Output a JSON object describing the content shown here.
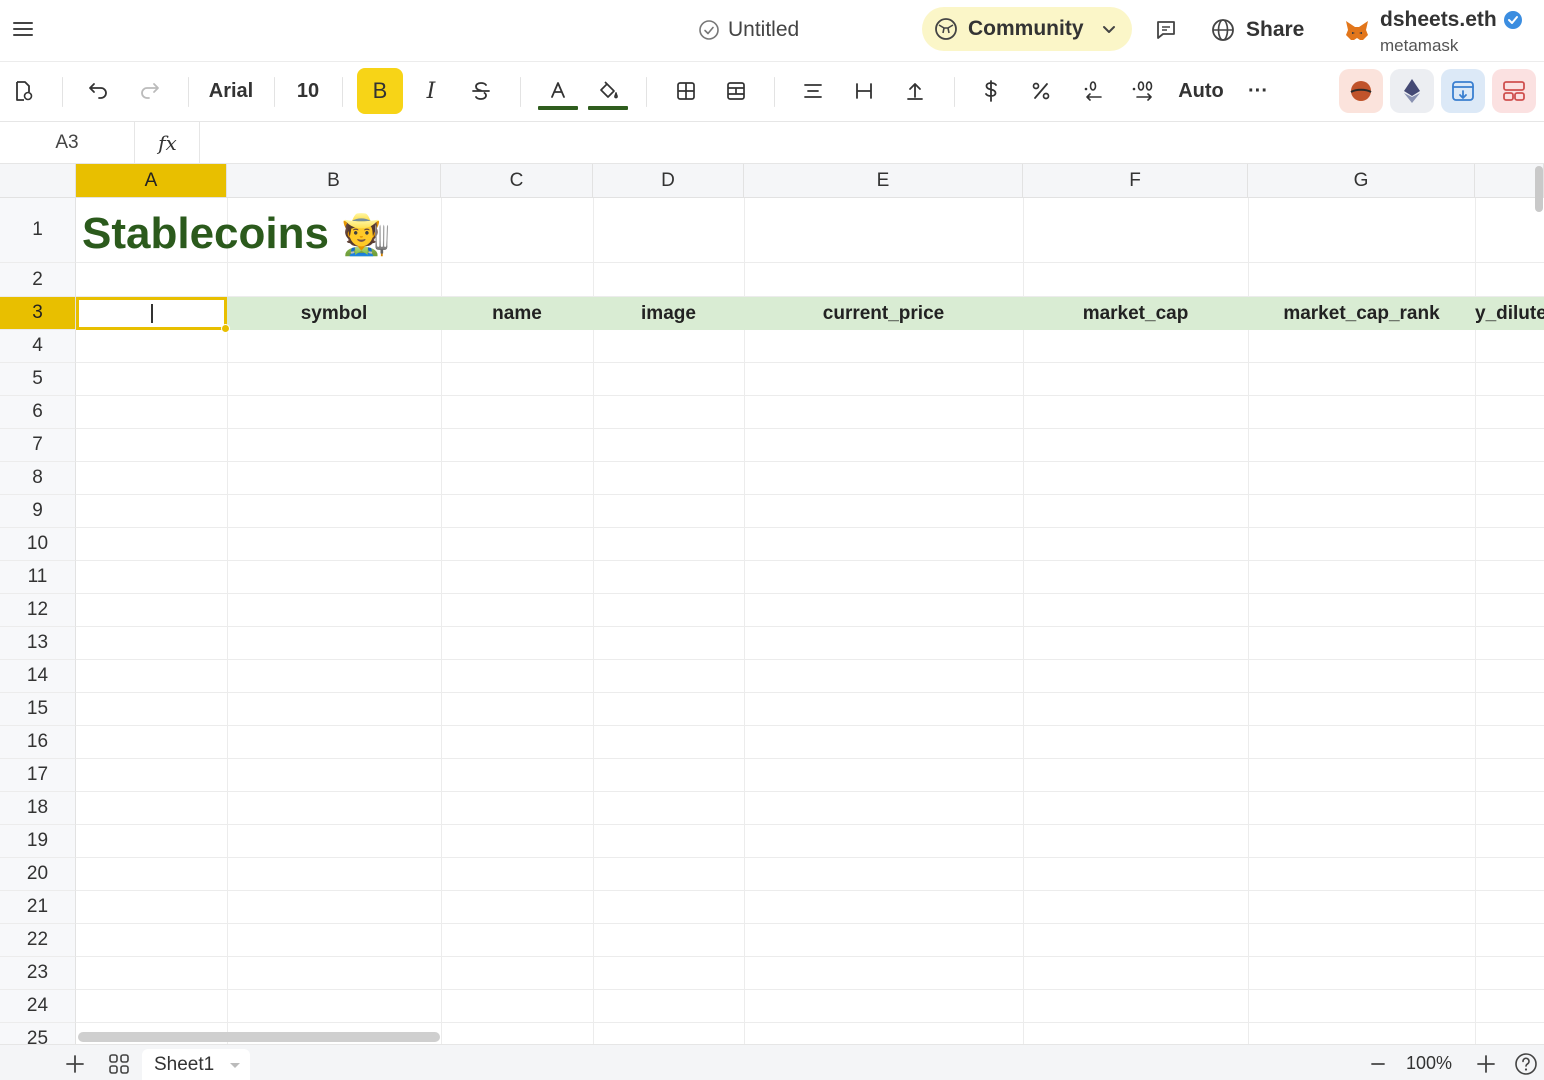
{
  "header": {
    "doc_title": "Untitled",
    "community_label": "Community",
    "share_label": "Share",
    "user_name": "dsheets.eth",
    "user_wallet": "metamask"
  },
  "toolbar": {
    "font_name": "Arial",
    "font_size": "10",
    "bold": "B",
    "italic": "I",
    "auto_label": "Auto",
    "more": "···",
    "text_color": "#2f5d1e",
    "fill_color": "#2f5d1e"
  },
  "formula": {
    "cell_ref": "A3",
    "fx_label": "fx"
  },
  "grid": {
    "columns": [
      "A",
      "B",
      "C",
      "D",
      "E",
      "F",
      "G"
    ],
    "rows": [
      "1",
      "2",
      "3",
      "4",
      "5",
      "6",
      "7",
      "8",
      "9",
      "10",
      "11",
      "12",
      "13",
      "14",
      "15",
      "16",
      "17",
      "18",
      "19",
      "20",
      "21",
      "22",
      "23",
      "24",
      "25"
    ],
    "title": "Stablecoins",
    "title_emoji": "🧑‍🌾",
    "headers": [
      "symbol",
      "name",
      "image",
      "current_price",
      "market_cap",
      "market_cap_rank",
      "y_dilute"
    ],
    "selected_row": "3",
    "selected_col": "A"
  },
  "footer": {
    "sheet_name": "Sheet1",
    "zoom": "100%"
  },
  "colors": {
    "accent": "#e8bf00",
    "title_green": "#2b5a1c",
    "header_band": "#d9ecd3",
    "community_bg": "#fbf6c8"
  }
}
